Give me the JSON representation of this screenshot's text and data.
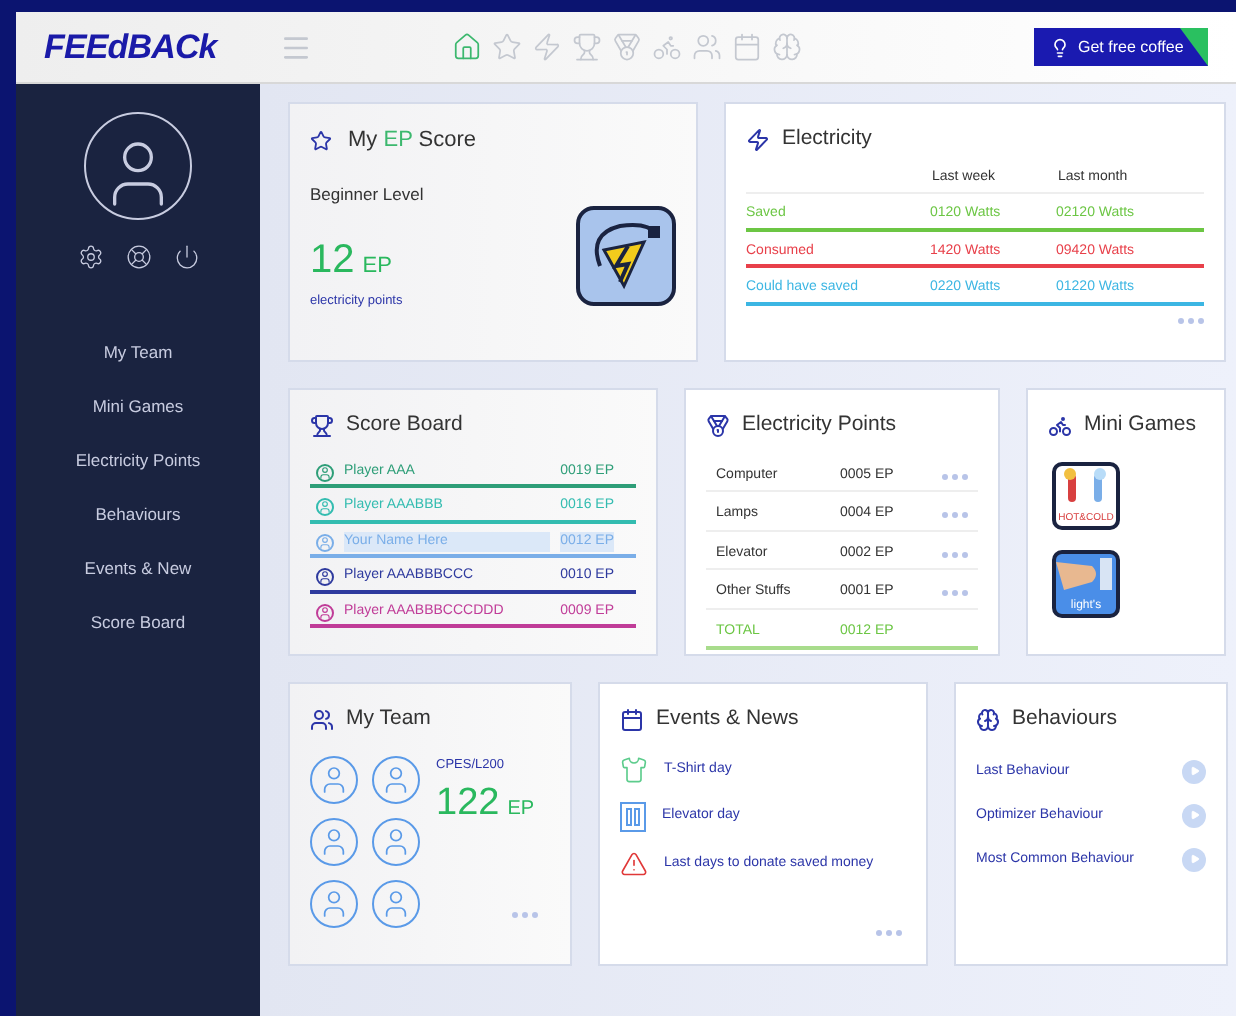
{
  "header": {
    "logo": "FEEdBACk",
    "nav": [
      {
        "selected": true
      },
      {
        "selected": false
      },
      {
        "selected": false
      },
      {
        "selected": false
      },
      {
        "selected": false
      },
      {
        "selected": false
      },
      {
        "selected": false
      },
      {
        "selected": false
      },
      {
        "selected": false
      }
    ],
    "cta": "Get free coffee"
  },
  "sidebar": {
    "items": [
      {
        "label": "My Team"
      },
      {
        "label": "Mini Games"
      },
      {
        "label": "Electricity Points"
      },
      {
        "label": "Behaviours"
      },
      {
        "label": "Events & New"
      },
      {
        "label": "Score Board"
      }
    ]
  },
  "ep_score": {
    "title_before": "My ",
    "title_highlight": "EP",
    "title_after": " Score",
    "level": "Beginner Level",
    "value": "12",
    "unit": "EP",
    "caption": "electricity points"
  },
  "electricity": {
    "title": "Electricity",
    "columns": [
      "Last week",
      "Last month"
    ],
    "rows": [
      {
        "label": "Saved",
        "week": "0120 Watts",
        "month": "02120 Watts",
        "color": "#6cc644"
      },
      {
        "label": "Consumed",
        "week": "1420 Watts",
        "month": "09420 Watts",
        "color": "#e8404a"
      },
      {
        "label": "Could have saved",
        "week": "0220 Watts",
        "month": "01220 Watts",
        "color": "#3cb6e3"
      }
    ]
  },
  "score_board": {
    "title": "Score Board",
    "rows": [
      {
        "name": "Player AAA",
        "points": "0019 EP",
        "color": "#2e9e78",
        "selected": false
      },
      {
        "name": "Player AAABBB",
        "points": "0016 EP",
        "color": "#33bcb0",
        "selected": false
      },
      {
        "name": "Your Name Here",
        "points": "0012 EP",
        "color": "#7aaee8",
        "selected": true
      },
      {
        "name": "Player AAABBBCCC",
        "points": "0010 EP",
        "color": "#2e3a9e",
        "selected": false
      },
      {
        "name": "Player AAABBBCCCDDD",
        "points": "0009 EP",
        "color": "#c03c98",
        "selected": false
      }
    ]
  },
  "electricity_points": {
    "title": "Electricity Points",
    "rows": [
      {
        "kind": "item",
        "label": "Computer",
        "points": "0005 EP"
      },
      {
        "kind": "item",
        "label": "Lamps",
        "points": "0004 EP"
      },
      {
        "kind": "item",
        "label": "Elevator",
        "points": "0002 EP"
      },
      {
        "kind": "item",
        "label": "Other Stuffs",
        "points": "0001 EP"
      },
      {
        "kind": "total",
        "label": "TOTAL",
        "points": "0012 EP"
      }
    ]
  },
  "mini_games": {
    "title": "Mini Games",
    "games": [
      {
        "kind": "thermo",
        "label": "HOT&COLD"
      },
      {
        "kind": "lights",
        "label": "light's"
      }
    ]
  },
  "my_team": {
    "title": "My Team",
    "group": "CPES/L200",
    "value": "122",
    "unit": "EP"
  },
  "events": {
    "title": "Events & News",
    "items": [
      {
        "kind": "shirt",
        "label": "T-Shirt day"
      },
      {
        "kind": "elevator",
        "label": "Elevator day"
      },
      {
        "kind": "warning",
        "label": "Last days to donate saved money"
      }
    ]
  },
  "behaviours": {
    "title": "Behaviours",
    "items": [
      {
        "label": "Last Behaviour"
      },
      {
        "label": "Optimizer Behaviour"
      },
      {
        "label": "Most Common Behaviour"
      }
    ]
  }
}
